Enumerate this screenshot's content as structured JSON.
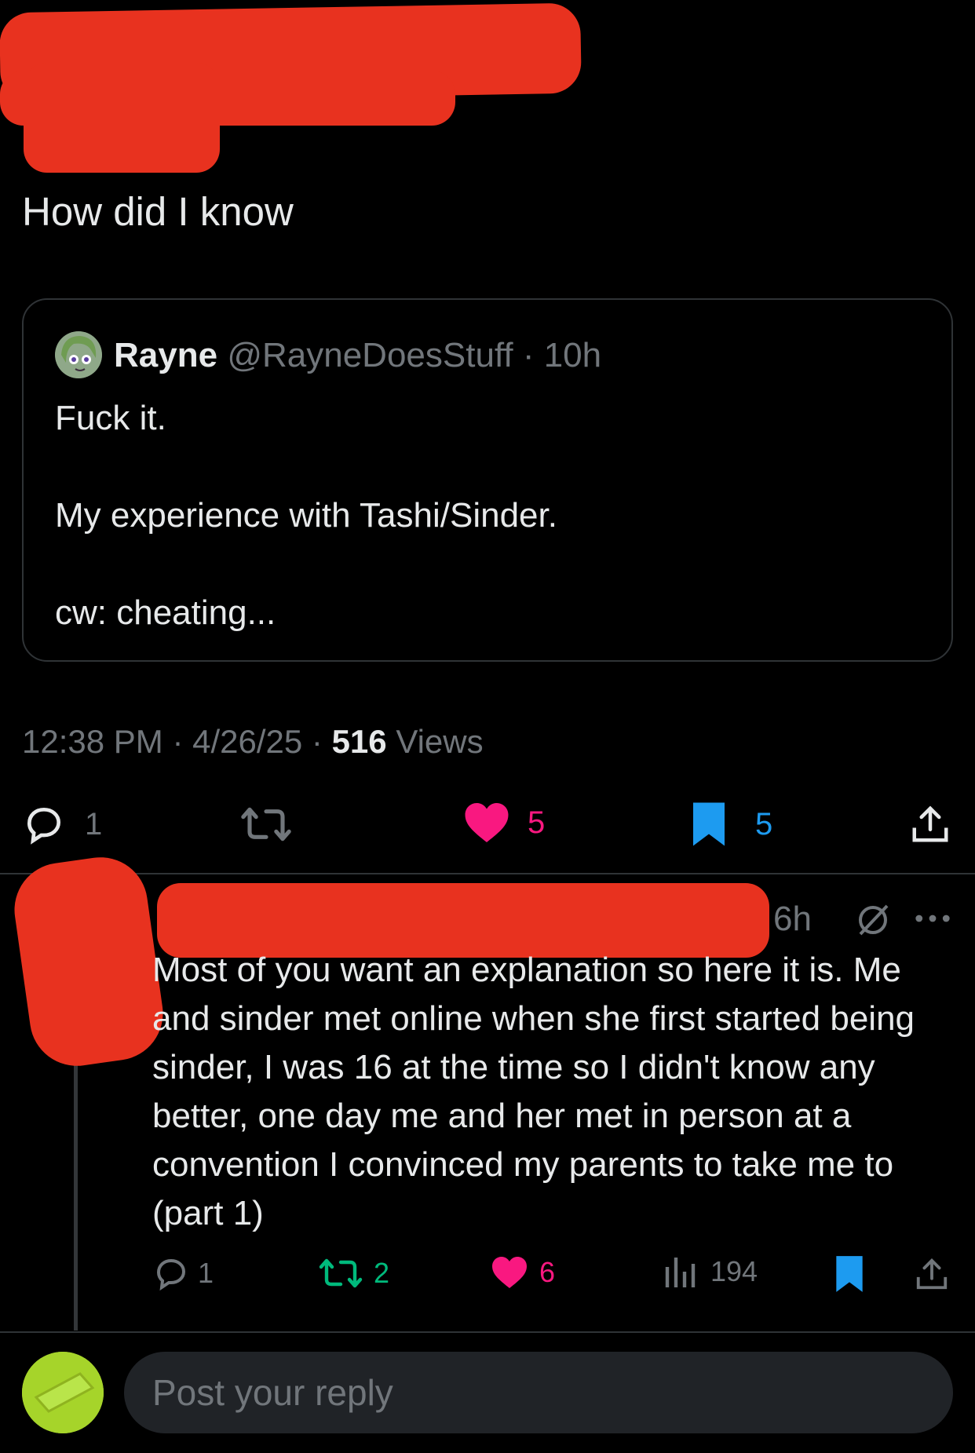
{
  "post": {
    "text": "How did I know",
    "quoted": {
      "name": "Rayne",
      "handle": "@RayneDoesStuff",
      "time": "10h",
      "lines": [
        "Fuck it.",
        "My experience with Tashi/Sinder.",
        "cw: cheating..."
      ]
    },
    "meta": {
      "time": "12:38 PM",
      "date": "4/26/25",
      "views_count": "516",
      "views_label": "Views"
    },
    "actions": {
      "replies": "1",
      "likes": "5",
      "bookmarks": "5"
    }
  },
  "reply": {
    "time": "6h",
    "text": "Most of you want an explanation so here it is. Me and sinder met online when she first started being sinder, I was 16 at the time so I didn't know any better, one day me and her met in person at a convention I convinced my parents to take me to (part 1)",
    "actions": {
      "replies": "1",
      "reposts": "2",
      "likes": "6",
      "views": "194"
    }
  },
  "composer": {
    "placeholder": "Post your reply"
  },
  "colors": {
    "like": "#f91880",
    "repost": "#00ba7c",
    "bookmark": "#1d9bf0",
    "muted": "#71767b",
    "redaction": "#e8321f"
  }
}
